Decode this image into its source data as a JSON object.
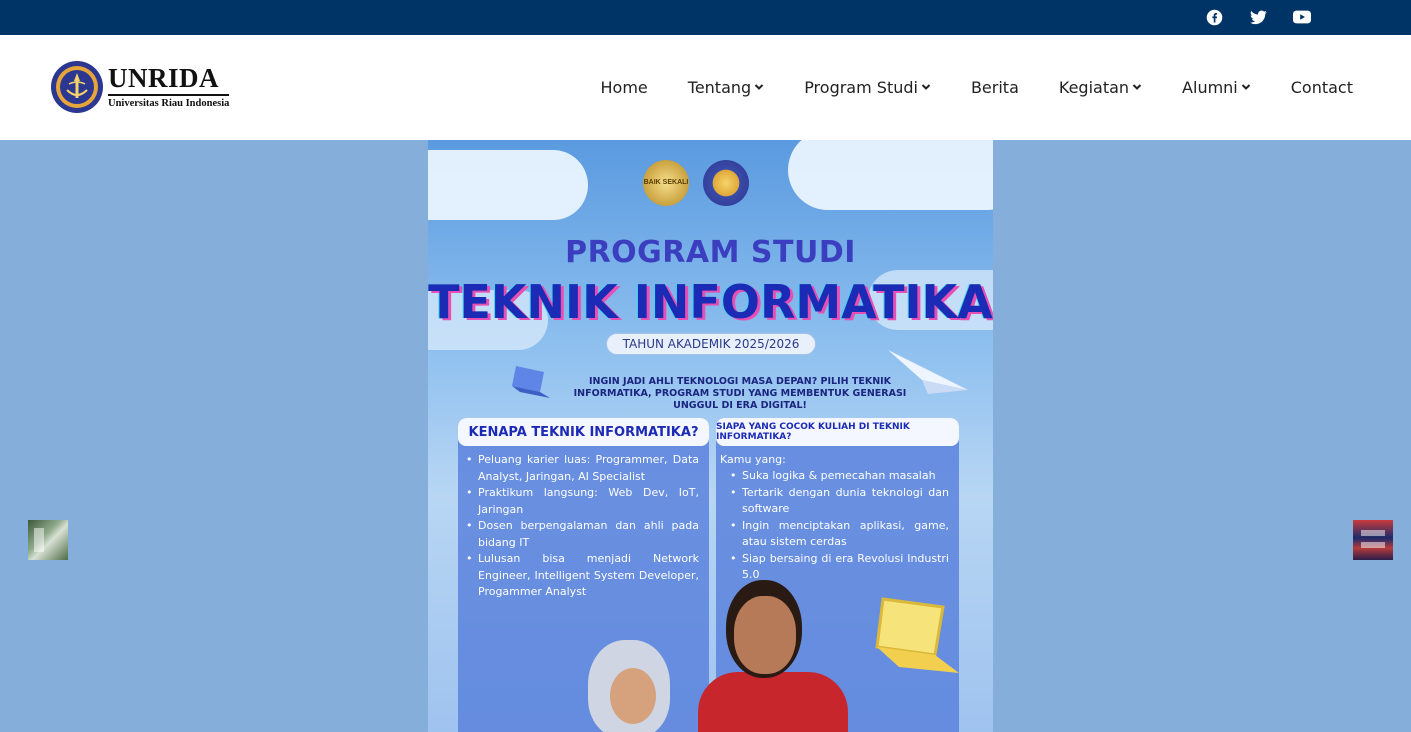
{
  "topbar": {
    "background": "#003366",
    "social": [
      {
        "icon": "facebook-icon"
      },
      {
        "icon": "twitter-icon"
      },
      {
        "icon": "youtube-icon"
      }
    ]
  },
  "logo": {
    "name": "UNRIDA",
    "subtitle": "Universitas Riau Indonesia"
  },
  "nav": {
    "items": [
      {
        "label": "Home",
        "dropdown": false
      },
      {
        "label": "Tentang",
        "dropdown": true
      },
      {
        "label": "Program Studi",
        "dropdown": true
      },
      {
        "label": "Berita",
        "dropdown": false
      },
      {
        "label": "Kegiatan",
        "dropdown": true
      },
      {
        "label": "Alumni",
        "dropdown": true
      },
      {
        "label": "Contact",
        "dropdown": false
      }
    ]
  },
  "hero": {
    "background": "#85aedb",
    "poster": {
      "badge_text": "BAIK SEKALI",
      "title_small": "PROGRAM STUDI",
      "title_large": "TEKNIK INFORMATIKA",
      "year": "TAHUN AKADEMIK 2025/2026",
      "lede": "INGIN JADI AHLI TEKNOLOGI MASA DEPAN? PILIH TEKNIK INFORMATIKA, PROGRAM STUDI YANG MEMBENTUK GENERASI UNGGUL DI ERA DIGITAL!",
      "left_card": {
        "heading": "KENAPA TEKNIK INFORMATIKA?",
        "points": [
          "Peluang karier luas: Programmer, Data Analyst, Jaringan, AI Specialist",
          "Praktikum langsung: Web Dev, IoT, Jaringan",
          "Dosen berpengalaman dan ahli pada bidang IT",
          "Lulusan bisa menjadi Network Engineer, Intelligent System Developer, Progammer Analyst"
        ]
      },
      "right_card": {
        "heading": "SIAPA YANG COCOK KULIAH DI TEKNIK INFORMATIKA?",
        "intro": "Kamu yang:",
        "points": [
          "Suka logika & pemecahan masalah",
          "Tertarik dengan dunia teknologi dan software",
          "Ingin menciptakan aplikasi, game, atau sistem cerdas",
          "Siap bersaing di era Revolusi Industri 5.0"
        ]
      }
    }
  }
}
